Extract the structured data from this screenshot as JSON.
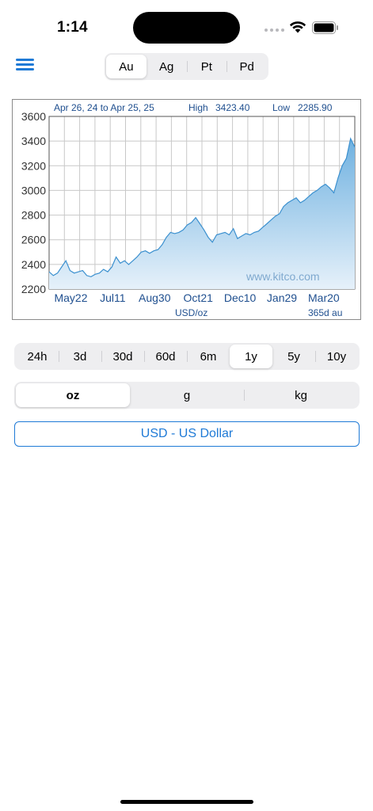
{
  "status_bar": {
    "time": "1:14"
  },
  "header": {
    "menu_icon": "hamburger-menu-icon",
    "metals": [
      {
        "label": "Au",
        "selected": true
      },
      {
        "label": "Ag",
        "selected": false
      },
      {
        "label": "Pt",
        "selected": false
      },
      {
        "label": "Pd",
        "selected": false
      }
    ]
  },
  "chart_data": {
    "type": "area",
    "date_range": "Apr 26, 24 to Apr 25, 25",
    "high_label": "High",
    "high": "3423.40",
    "low_label": "Low",
    "low": "2285.90",
    "watermark": "www.kitco.com",
    "ylabel": "USD/oz",
    "period_label": "365d au",
    "ylim": [
      2200,
      3600
    ],
    "y_ticks": [
      "3600",
      "3400",
      "3200",
      "3000",
      "2800",
      "2600",
      "2400",
      "2200"
    ],
    "x_ticks": [
      "May22",
      "Jul11",
      "Aug30",
      "Oct21",
      "Dec10",
      "Jan29",
      "Mar20"
    ],
    "x_tick_day_index": [
      26,
      76,
      126,
      178,
      228,
      278,
      328
    ],
    "days": 365,
    "series": [
      {
        "day": [
          0,
          5,
          10,
          15,
          20,
          25,
          30,
          35,
          40,
          45,
          50,
          55,
          60,
          65,
          70,
          75,
          80,
          85,
          90,
          95,
          100,
          105,
          110,
          115,
          120,
          125,
          130,
          135,
          140,
          145,
          150,
          155,
          160,
          165,
          170,
          175,
          180,
          185,
          190,
          195,
          200,
          205,
          210,
          215,
          220,
          225,
          230,
          235,
          240,
          245,
          250,
          255,
          260,
          265,
          270,
          275,
          280,
          285,
          290,
          295,
          300,
          305,
          310,
          315,
          320,
          325,
          330,
          335,
          340,
          345,
          350,
          355,
          360,
          365
        ],
        "value": [
          2340,
          2310,
          2330,
          2380,
          2430,
          2350,
          2330,
          2340,
          2350,
          2310,
          2300,
          2320,
          2330,
          2360,
          2340,
          2380,
          2460,
          2410,
          2430,
          2400,
          2430,
          2460,
          2500,
          2510,
          2490,
          2510,
          2520,
          2560,
          2620,
          2660,
          2650,
          2660,
          2680,
          2720,
          2740,
          2780,
          2730,
          2680,
          2620,
          2580,
          2640,
          2650,
          2660,
          2640,
          2690,
          2610,
          2630,
          2650,
          2640,
          2660,
          2670,
          2700,
          2730,
          2760,
          2790,
          2810,
          2870,
          2900,
          2920,
          2940,
          2900,
          2920,
          2950,
          2980,
          3000,
          3030,
          3050,
          3020,
          2980,
          3100,
          3200,
          3260,
          3420,
          3350
        ]
      }
    ]
  },
  "periods": [
    {
      "label": "24h",
      "selected": false
    },
    {
      "label": "3d",
      "selected": false
    },
    {
      "label": "30d",
      "selected": false
    },
    {
      "label": "60d",
      "selected": false
    },
    {
      "label": "6m",
      "selected": false
    },
    {
      "label": "1y",
      "selected": true
    },
    {
      "label": "5y",
      "selected": false
    },
    {
      "label": "10y",
      "selected": false
    }
  ],
  "units": [
    {
      "label": "oz",
      "selected": true
    },
    {
      "label": "g",
      "selected": false
    },
    {
      "label": "kg",
      "selected": false
    }
  ],
  "currency": {
    "label": "USD - US Dollar"
  },
  "colors": {
    "accent": "#1f7ad6",
    "chart_line": "#3b90cf",
    "chart_fill_top": "#6fb1e0",
    "chart_fill_bottom": "#e6f1fa",
    "chart_text": "#1f4f8f"
  }
}
